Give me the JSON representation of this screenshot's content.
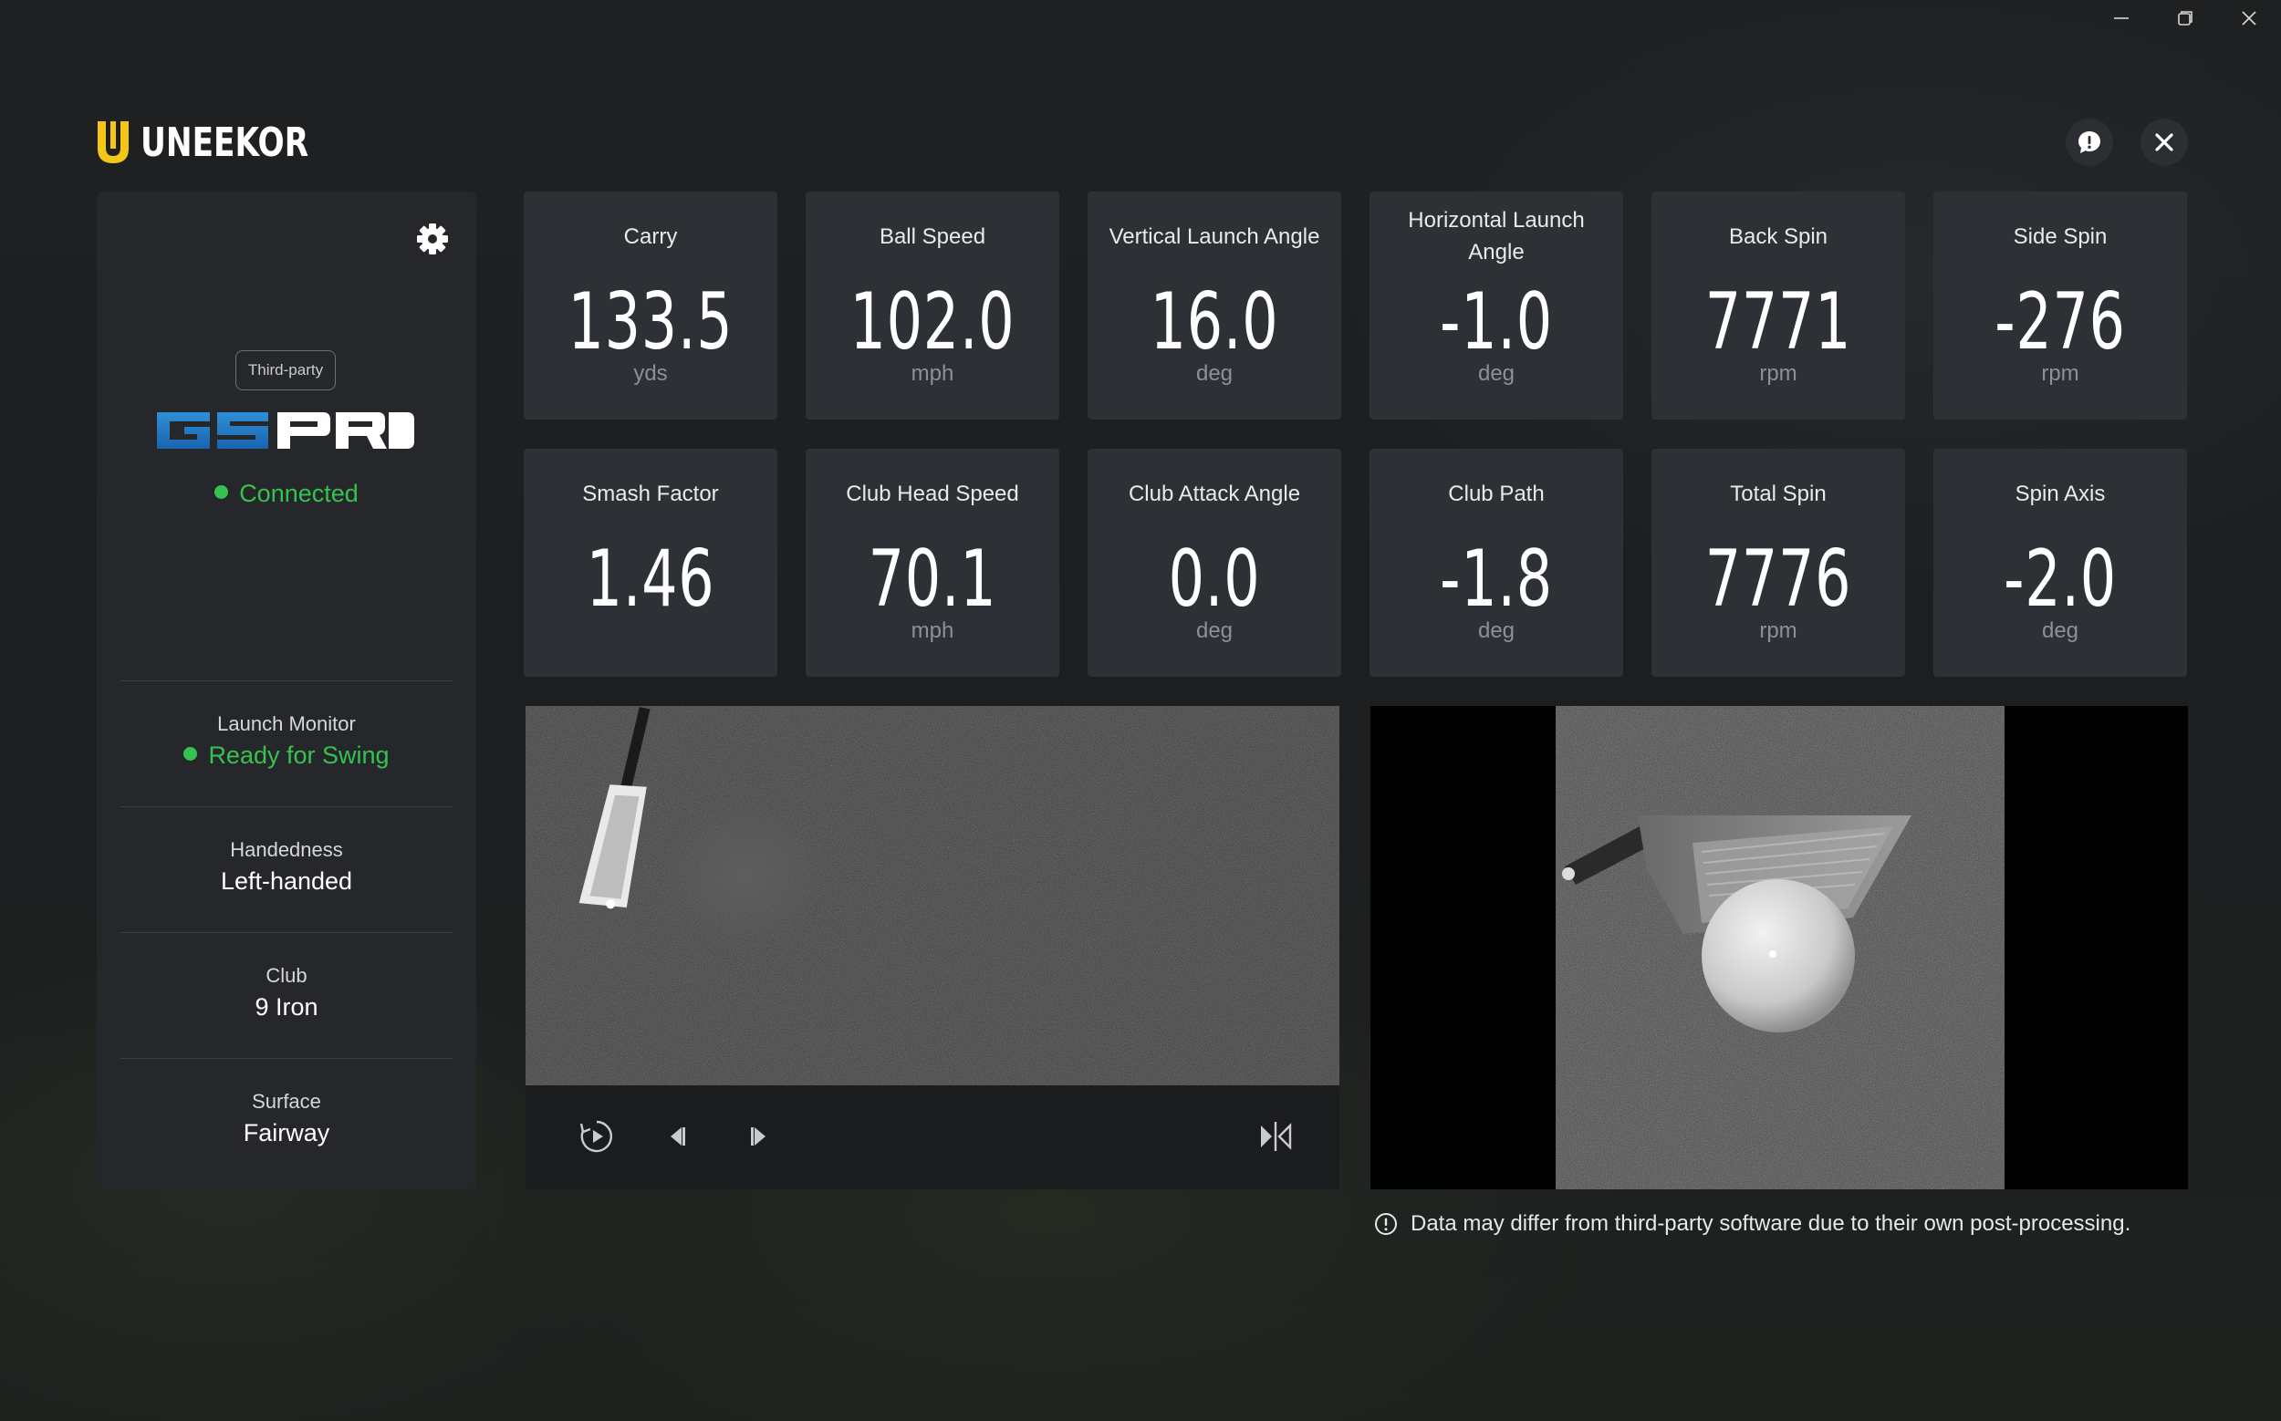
{
  "window": {
    "minimize_icon": "minimize-icon",
    "restore_icon": "restore-icon",
    "close_icon": "close-icon"
  },
  "brand": {
    "name": "UNEEKOR",
    "accent_color": "#f5c518"
  },
  "sidebar": {
    "badge": "Third-party",
    "software_logo": "GSPRO",
    "status": "Connected",
    "status_color": "#35c34f",
    "items": [
      {
        "label": "Launch Monitor",
        "value": "Ready for Swing",
        "green": true
      },
      {
        "label": "Handedness",
        "value": "Left-handed",
        "green": false
      },
      {
        "label": "Club",
        "value": "9 Iron",
        "green": false
      },
      {
        "label": "Surface",
        "value": "Fairway",
        "green": false
      }
    ]
  },
  "metrics": [
    {
      "label": "Carry",
      "value": "133.5",
      "unit": "yds"
    },
    {
      "label": "Ball Speed",
      "value": "102.0",
      "unit": "mph"
    },
    {
      "label": "Vertical Launch Angle",
      "value": "16.0",
      "unit": "deg"
    },
    {
      "label": "Horizontal Launch Angle",
      "value": "-1.0",
      "unit": "deg"
    },
    {
      "label": "Back Spin",
      "value": "7771",
      "unit": "rpm"
    },
    {
      "label": "Side Spin",
      "value": "-276",
      "unit": "rpm"
    },
    {
      "label": "Smash Factor",
      "value": "1.46",
      "unit": ""
    },
    {
      "label": "Club Head Speed",
      "value": "70.1",
      "unit": "mph"
    },
    {
      "label": "Club Attack Angle",
      "value": "0.0",
      "unit": "deg"
    },
    {
      "label": "Club Path",
      "value": "-1.8",
      "unit": "deg"
    },
    {
      "label": "Total Spin",
      "value": "7776",
      "unit": "rpm"
    },
    {
      "label": "Spin Axis",
      "value": "-2.0",
      "unit": "deg"
    }
  ],
  "player": {
    "replay_icon": "replay-icon",
    "prev_frame_icon": "previous-frame-icon",
    "next_frame_icon": "next-frame-icon",
    "flip_icon": "flip-horizontal-icon"
  },
  "disclaimer": "Data may differ from third-party software due to their own post-processing."
}
